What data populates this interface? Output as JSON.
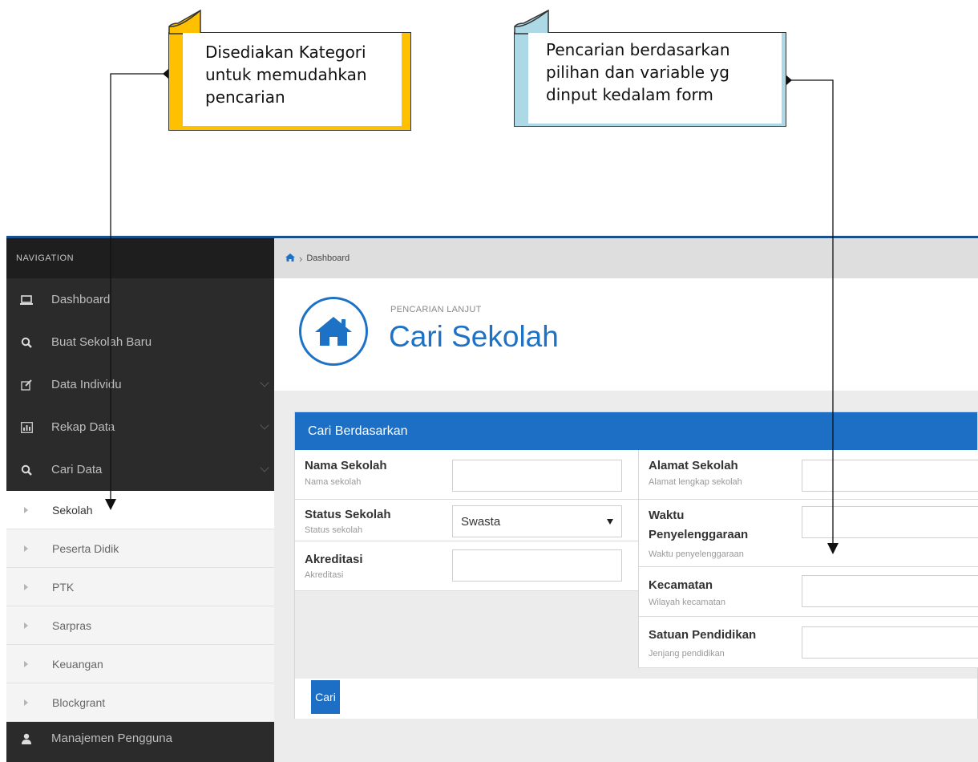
{
  "callouts": {
    "left": {
      "text": "Disediakan Kategori untuk memudahkan pencarian",
      "color": "#ffc000"
    },
    "right": {
      "text": "Pencarian berdasarkan pilihan dan variable yg dinput kedalam form",
      "color": "#add8e6"
    }
  },
  "sidebar": {
    "header": "NAVIGATION",
    "items": [
      {
        "label": "Dashboard",
        "icon": "laptop-icon"
      },
      {
        "label": "Buat Sekolah Baru",
        "icon": "search-icon"
      },
      {
        "label": "Data Individu",
        "icon": "edit-icon"
      },
      {
        "label": "Rekap Data",
        "icon": "bar-chart-icon"
      },
      {
        "label": "Cari Data",
        "icon": "search-icon"
      }
    ],
    "subitems": [
      "Sekolah",
      "Peserta Didik",
      "PTK",
      "Sarpras",
      "Keuangan",
      "Blockgrant"
    ],
    "active_subitem": "Sekolah",
    "bottom_item": {
      "label": "Manajemen Pengguna",
      "icon": "user-icon"
    }
  },
  "breadcrumb": {
    "current": "Dashboard"
  },
  "page": {
    "subtitle": "PENCARIAN LANJUT",
    "title": "Cari Sekolah"
  },
  "form": {
    "heading": "Cari Berdasarkan",
    "left_fields": [
      {
        "label": "Nama Sekolah",
        "hint": "Nama sekolah",
        "value": ""
      },
      {
        "label": "Status Sekolah",
        "hint": "Status sekolah",
        "value": "Swasta"
      },
      {
        "label": "Akreditasi",
        "hint": "Akreditasi",
        "value": ""
      }
    ],
    "right_fields": [
      {
        "label": "Alamat Sekolah",
        "hint": "Alamat lengkap sekolah",
        "value": ""
      },
      {
        "label": "Waktu Penyelenggaraan",
        "hint": "Waktu penyelenggaraan",
        "value": ""
      },
      {
        "label": "Kecamatan",
        "hint": "Wilayah kecamatan",
        "value": ""
      },
      {
        "label": "Satuan Pendidikan",
        "hint": "Jenjang pendidikan",
        "value": ""
      }
    ],
    "submit_label": "Cari"
  },
  "colors": {
    "accent": "#1c6fc4",
    "sidebar": "#2b2b2b",
    "frame_top": "#1a4f8b"
  }
}
